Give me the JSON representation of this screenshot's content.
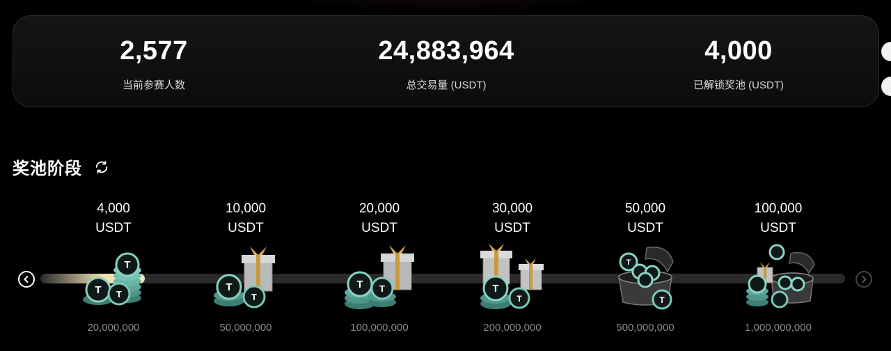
{
  "stats": [
    {
      "value": "2,577",
      "label": "当前参赛人数"
    },
    {
      "value": "24,883,964",
      "label": "总交易量 (USDT)"
    },
    {
      "value": "4,000",
      "label": "已解锁奖池 (USDT)"
    }
  ],
  "section": {
    "title": "奖池阶段",
    "refresh_icon": "refresh-icon"
  },
  "progress": {
    "fraction": 0.13
  },
  "nav": {
    "prev_icon": "chevron-left-icon",
    "next_icon": "chevron-right-icon"
  },
  "tiers": [
    {
      "reward": "4,000",
      "unit": "USDT",
      "threshold": "20,000,000",
      "art": "coin-stack"
    },
    {
      "reward": "10,000",
      "unit": "USDT",
      "threshold": "50,000,000",
      "art": "gift-coins"
    },
    {
      "reward": "20,000",
      "unit": "USDT",
      "threshold": "100,000,000",
      "art": "gift-coins"
    },
    {
      "reward": "30,000",
      "unit": "USDT",
      "threshold": "200,000,000",
      "art": "gifts-coins"
    },
    {
      "reward": "50,000",
      "unit": "USDT",
      "threshold": "500,000,000",
      "art": "chest-coins"
    },
    {
      "reward": "100,000",
      "unit": "USDT",
      "threshold": "1,000,000,000",
      "art": "chest-gift-coins"
    }
  ],
  "colors": {
    "accent_gold": "#efe0b0",
    "coin_teal": "#5fa89a",
    "track": "#2a2a2a"
  }
}
